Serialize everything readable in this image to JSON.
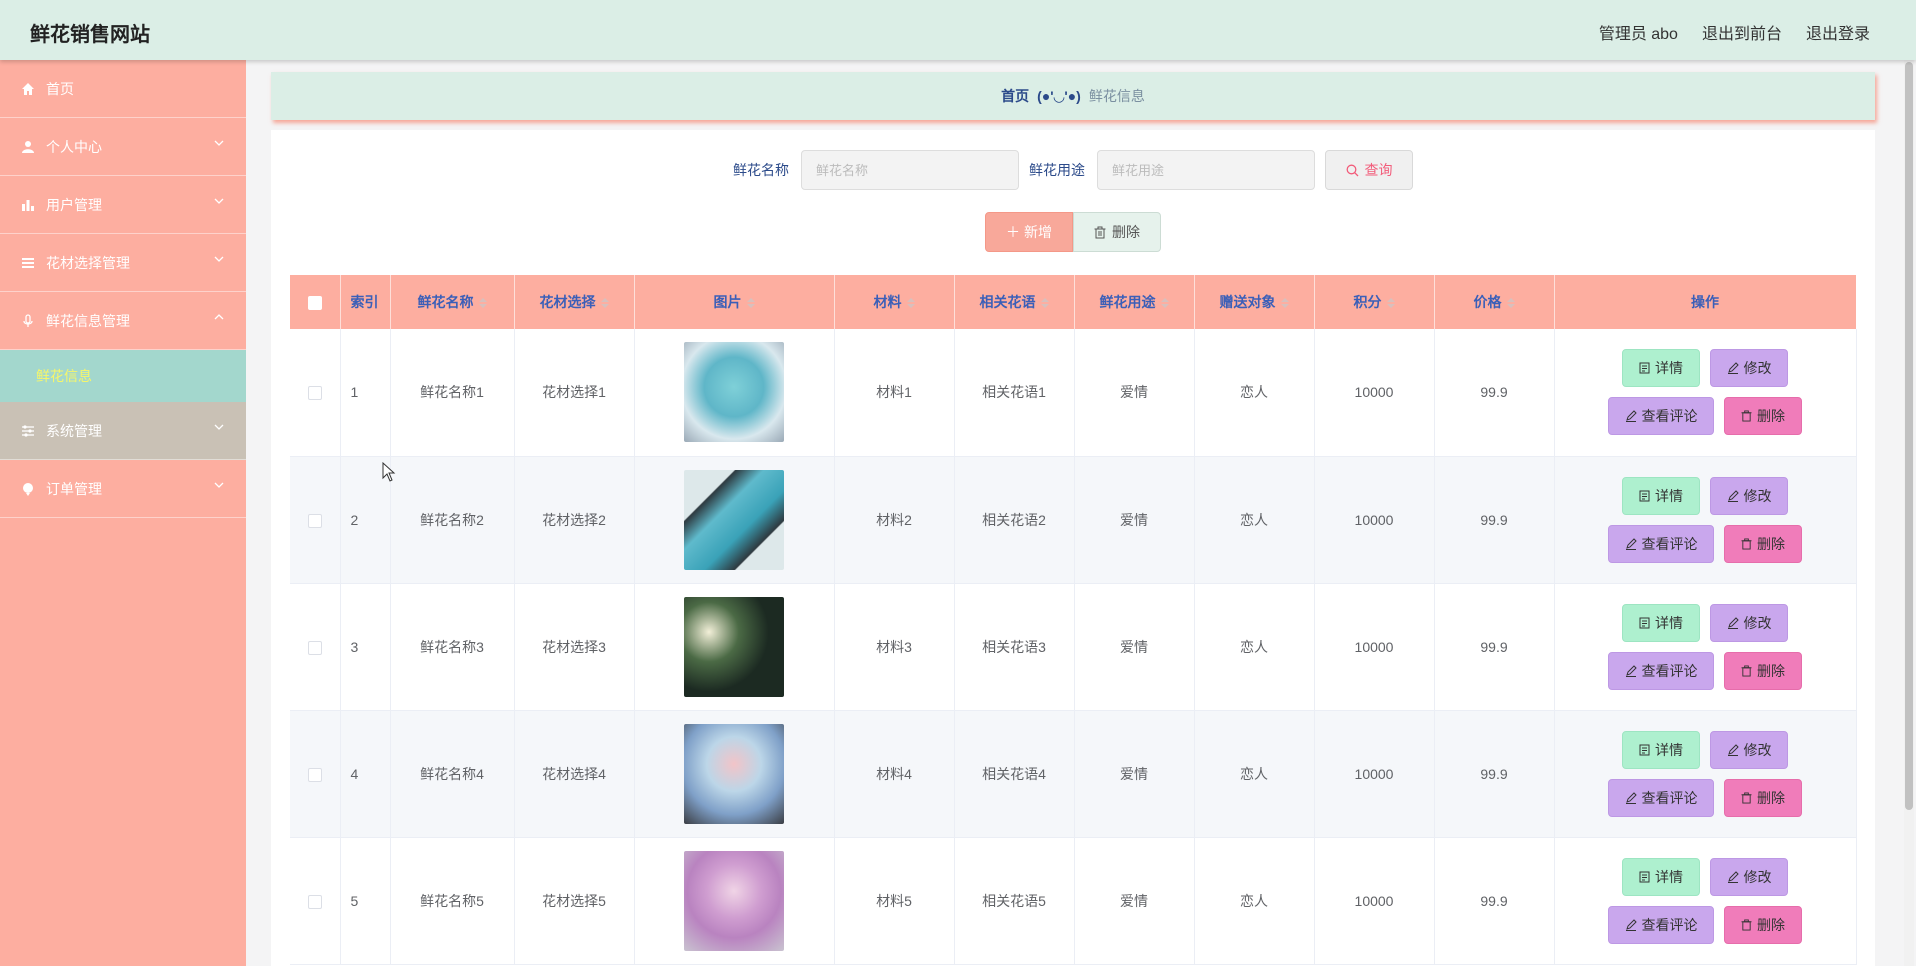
{
  "header": {
    "brand": "鲜花销售网站",
    "admin": "管理员 abo",
    "to_front": "退出到前台",
    "logout": "退出登录"
  },
  "sidebar": {
    "items": [
      {
        "label": "首页",
        "icon": "home-icon"
      },
      {
        "label": "个人中心",
        "icon": "user-icon"
      },
      {
        "label": "用户管理",
        "icon": "bar-chart-icon"
      },
      {
        "label": "花材选择管理",
        "icon": "list-icon"
      },
      {
        "label": "鲜花信息管理",
        "icon": "microphone-icon"
      },
      {
        "label": "系统管理",
        "icon": "sliders-icon"
      },
      {
        "label": "订单管理",
        "icon": "pin-icon"
      }
    ],
    "active_sub": "鲜花信息"
  },
  "breadcrumb": {
    "home": "首页",
    "sep": "(●'◡'●)",
    "current": "鲜花信息"
  },
  "search": {
    "name_label": "鲜花名称",
    "name_placeholder": "鲜花名称",
    "use_label": "鲜花用途",
    "use_placeholder": "鲜花用途",
    "query_label": "查询"
  },
  "actions": {
    "add_label": "新增",
    "delete_label": "删除"
  },
  "table": {
    "columns": [
      "索引",
      "鲜花名称",
      "花材选择",
      "图片",
      "材料",
      "相关花语",
      "鲜花用途",
      "赠送对象",
      "积分",
      "价格",
      "操作"
    ],
    "rows": [
      {
        "idx": "1",
        "name": "鲜花名称1",
        "material_choice": "花材选择1",
        "material": "材料1",
        "language": "相关花语1",
        "use": "爱情",
        "target": "恋人",
        "points": "10000",
        "price": "99.9"
      },
      {
        "idx": "2",
        "name": "鲜花名称2",
        "material_choice": "花材选择2",
        "material": "材料2",
        "language": "相关花语2",
        "use": "爱情",
        "target": "恋人",
        "points": "10000",
        "price": "99.9"
      },
      {
        "idx": "3",
        "name": "鲜花名称3",
        "material_choice": "花材选择3",
        "material": "材料3",
        "language": "相关花语3",
        "use": "爱情",
        "target": "恋人",
        "points": "10000",
        "price": "99.9"
      },
      {
        "idx": "4",
        "name": "鲜花名称4",
        "material_choice": "花材选择4",
        "material": "材料4",
        "language": "相关花语4",
        "use": "爱情",
        "target": "恋人",
        "points": "10000",
        "price": "99.9"
      },
      {
        "idx": "5",
        "name": "鲜花名称5",
        "material_choice": "花材选择5",
        "material": "材料5",
        "language": "相关花语5",
        "use": "爱情",
        "target": "恋人",
        "points": "10000",
        "price": "99.9"
      }
    ],
    "ops": {
      "detail": "详情",
      "edit": "修改",
      "review": "查看评论",
      "delete": "删除"
    }
  },
  "colors": {
    "header_bg": "#dbeee6",
    "sidebar_bg": "#fdaea0",
    "submenu_bg": "#a3d7cd",
    "table_head_bg": "#fdaea0"
  }
}
